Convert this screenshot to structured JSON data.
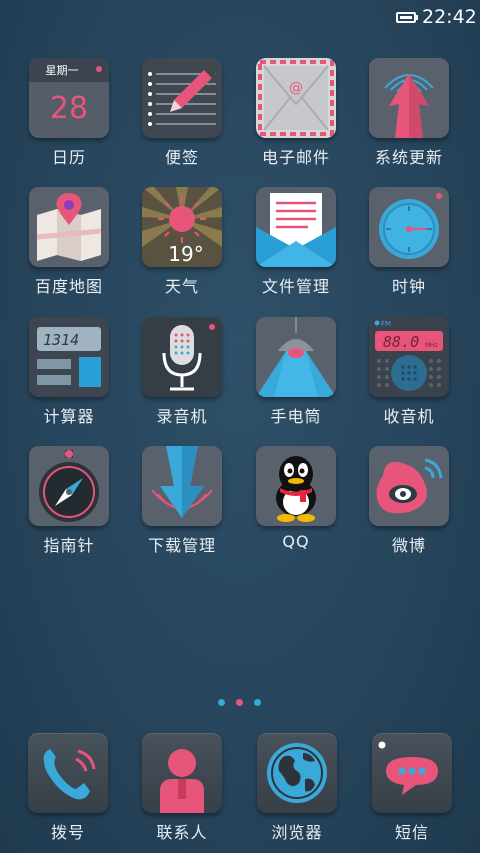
{
  "status_bar": {
    "time": "22:42",
    "battery_icon": "battery-full-icon"
  },
  "apps": [
    {
      "label": "日历",
      "icon": "calendar-icon",
      "weekday": "星期一",
      "day": "28"
    },
    {
      "label": "便签",
      "icon": "notepad-icon"
    },
    {
      "label": "电子邮件",
      "icon": "email-icon"
    },
    {
      "label": "系统更新",
      "icon": "system-update-icon"
    },
    {
      "label": "百度地图",
      "icon": "map-icon"
    },
    {
      "label": "天气",
      "icon": "weather-icon",
      "temperature": "19°"
    },
    {
      "label": "文件管理",
      "icon": "file-manager-icon"
    },
    {
      "label": "时钟",
      "icon": "clock-icon"
    },
    {
      "label": "计算器",
      "icon": "calculator-icon",
      "display": "1314"
    },
    {
      "label": "录音机",
      "icon": "recorder-icon"
    },
    {
      "label": "手电筒",
      "icon": "flashlight-icon"
    },
    {
      "label": "收音机",
      "icon": "radio-icon",
      "band": "FM",
      "frequency": "88.0",
      "unit": "MHz"
    },
    {
      "label": "指南针",
      "icon": "compass-icon"
    },
    {
      "label": "下载管理",
      "icon": "download-manager-icon"
    },
    {
      "label": "QQ",
      "icon": "qq-icon"
    },
    {
      "label": "微博",
      "icon": "weibo-icon"
    }
  ],
  "page_indicator": {
    "count": 3,
    "active": 1,
    "colors": [
      "#3aa9d9",
      "#e8557a",
      "#3aa9d9"
    ]
  },
  "dock": [
    {
      "label": "拨号",
      "icon": "phone-icon"
    },
    {
      "label": "联系人",
      "icon": "contacts-icon"
    },
    {
      "label": "浏览器",
      "icon": "browser-icon"
    },
    {
      "label": "短信",
      "icon": "messages-icon"
    }
  ],
  "colors": {
    "accent_pink": "#e8557a",
    "accent_blue": "#3aa9d9",
    "background": "#2a4860"
  }
}
